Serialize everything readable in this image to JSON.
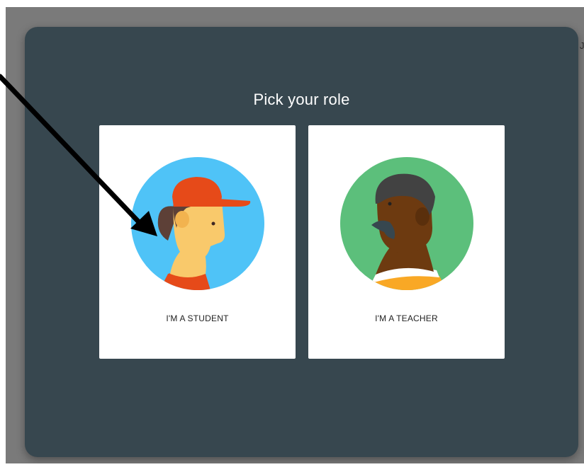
{
  "dialog": {
    "title": "Pick your role"
  },
  "roles": [
    {
      "label": "I'M A STUDENT",
      "icon": "student-avatar-icon",
      "circle_color": "#4fc3f7"
    },
    {
      "label": "I'M A TEACHER",
      "icon": "teacher-avatar-icon",
      "circle_color": "#5cbf7b"
    }
  ],
  "background": {
    "partial_text": "Jo"
  },
  "colors": {
    "dialog_bg": "#37474f",
    "overlay": "#7a7a7a",
    "card_bg": "#ffffff"
  }
}
